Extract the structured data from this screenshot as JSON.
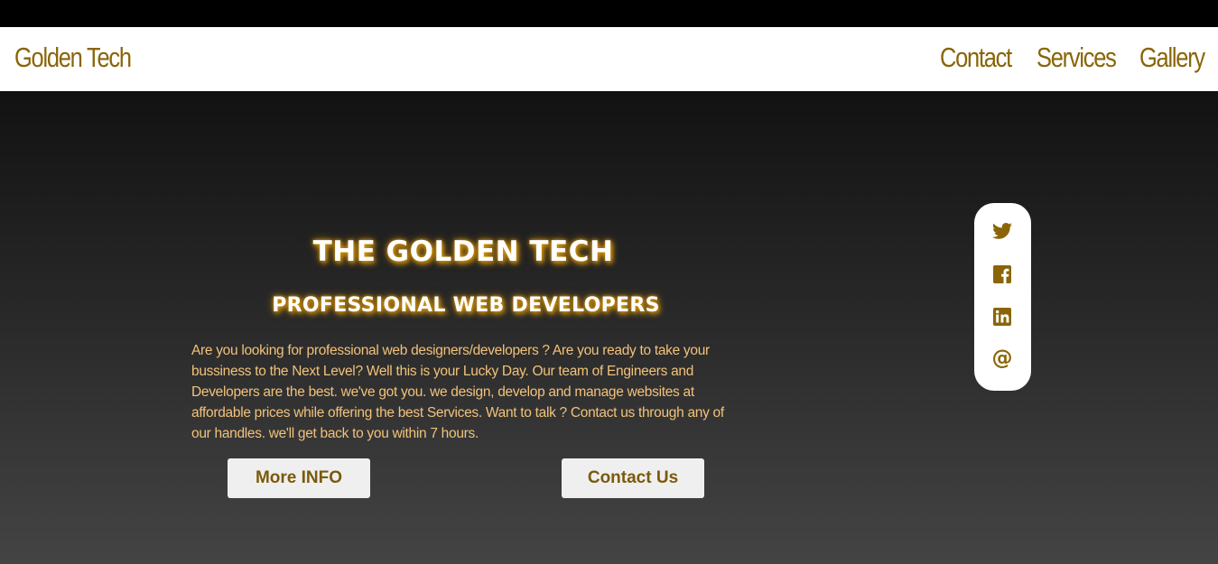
{
  "header": {
    "brand": "Golden Tech",
    "nav": [
      {
        "label": "Contact"
      },
      {
        "label": "Services"
      },
      {
        "label": "Gallery"
      }
    ]
  },
  "hero": {
    "title": "THE GOLDEN TECH",
    "subtitle": "PROFESSIONAL WEB DEVELOPERS",
    "description": "Are you looking for professional web designers/developers ? Are you ready to take your bussiness to the Next Level? Well this is your Lucky Day. Our team of Engineers and Developers are the best. we've got you. we design, develop and manage websites at affordable prices while offering the best Services. Want to talk ? Contact us through any of our handles. we'll get back to you within 7 hours.",
    "buttons": {
      "more_info": "More INFO",
      "contact_us": "Contact Us"
    }
  },
  "social": {
    "icons": [
      "twitter-icon",
      "facebook-icon",
      "linkedin-icon",
      "email-icon"
    ],
    "email_glyph": "@"
  },
  "colors": {
    "gold": "#8a6508",
    "gold_light": "#f2c27a",
    "glow": "#d99a12",
    "navbar_bg": "#ffffff",
    "hero_top": "#121212",
    "hero_bottom": "#444444"
  }
}
